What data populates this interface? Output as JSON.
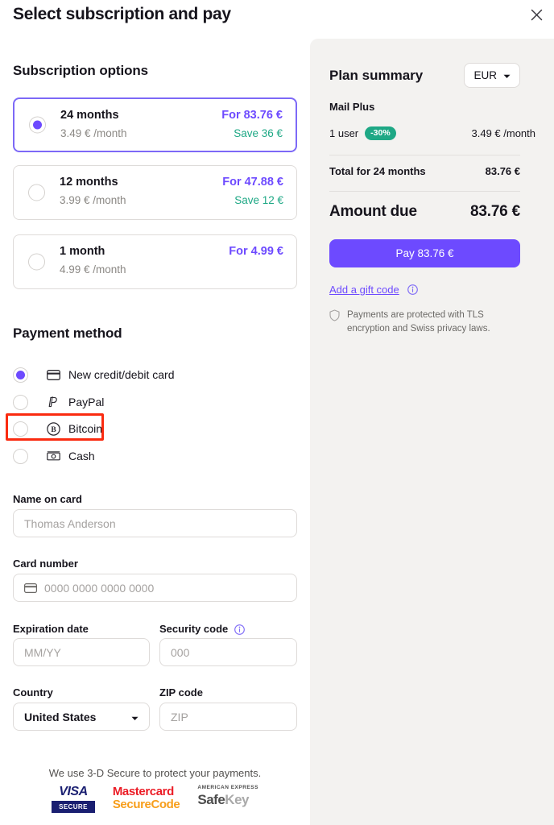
{
  "header": {
    "title": "Select subscription and pay",
    "close_icon": "close-icon"
  },
  "subscription": {
    "section_title": "Subscription options",
    "options": [
      {
        "name": "24 months",
        "per_month": "3.49 € /month",
        "price": "For 83.76 €",
        "save": "Save 36 €",
        "selected": true
      },
      {
        "name": "12 months",
        "per_month": "3.99 € /month",
        "price": "For 47.88 €",
        "save": "Save 12 €",
        "selected": false
      },
      {
        "name": "1 month",
        "per_month": "4.99 € /month",
        "price": "For 4.99 €",
        "save": "",
        "selected": false
      }
    ]
  },
  "payment_method": {
    "section_title": "Payment method",
    "options": [
      {
        "label": "New credit/debit card",
        "icon": "credit-card-icon",
        "selected": true,
        "highlighted": false
      },
      {
        "label": "PayPal",
        "icon": "paypal-icon",
        "selected": false,
        "highlighted": false
      },
      {
        "label": "Bitcoin",
        "icon": "bitcoin-icon",
        "selected": false,
        "highlighted": true
      },
      {
        "label": "Cash",
        "icon": "cash-icon",
        "selected": false,
        "highlighted": false
      }
    ]
  },
  "card_form": {
    "name_label": "Name on card",
    "name_placeholder": "Thomas Anderson",
    "card_label": "Card number",
    "card_placeholder": "0000 0000 0000 0000",
    "card_icon": "credit-card-icon",
    "expiration_label": "Expiration date",
    "expiration_placeholder": "MM/YY",
    "security_label": "Security code",
    "security_info_icon": "info-icon",
    "security_placeholder": "000",
    "country_label": "Country",
    "country_value": "United States",
    "country_caret_icon": "chevron-down-icon",
    "zip_label": "ZIP code",
    "zip_placeholder": "ZIP"
  },
  "footer": {
    "secure_note": "We use 3-D Secure to protect your payments.",
    "logos": [
      {
        "name": "visa-secure-logo",
        "line1": "VISA",
        "line2": "SECURE"
      },
      {
        "name": "mastercard-securecode-logo",
        "line1": "Mastercard",
        "line2": "SecureCode"
      },
      {
        "name": "amex-safekey-logo",
        "line1": "AMERICAN EXPRESS",
        "line2a": "Safe",
        "line2b": "Key"
      }
    ]
  },
  "summary": {
    "title": "Plan summary",
    "currency": "EUR",
    "currency_caret_icon": "chevron-down-icon",
    "plan_name": "Mail Plus",
    "users": "1 user",
    "discount_badge": "-30%",
    "unit_price": "3.49 € /month",
    "total_label": "Total for 24 months",
    "total_value": "83.76 €",
    "due_label": "Amount due",
    "due_value": "83.76 €",
    "pay_button": "Pay 83.76 €",
    "gift_link": "Add a gift code",
    "gift_info_icon": "info-icon",
    "tls_icon": "shield-icon",
    "tls_note": "Payments are protected with TLS encryption and Swiss privacy laws."
  },
  "colors": {
    "accent_purple": "#6d4aff",
    "selected_border": "#7d69f7",
    "success_green": "#1ea885",
    "highlight_red": "#fa2b10",
    "panel_bg": "#f3f2f0"
  }
}
